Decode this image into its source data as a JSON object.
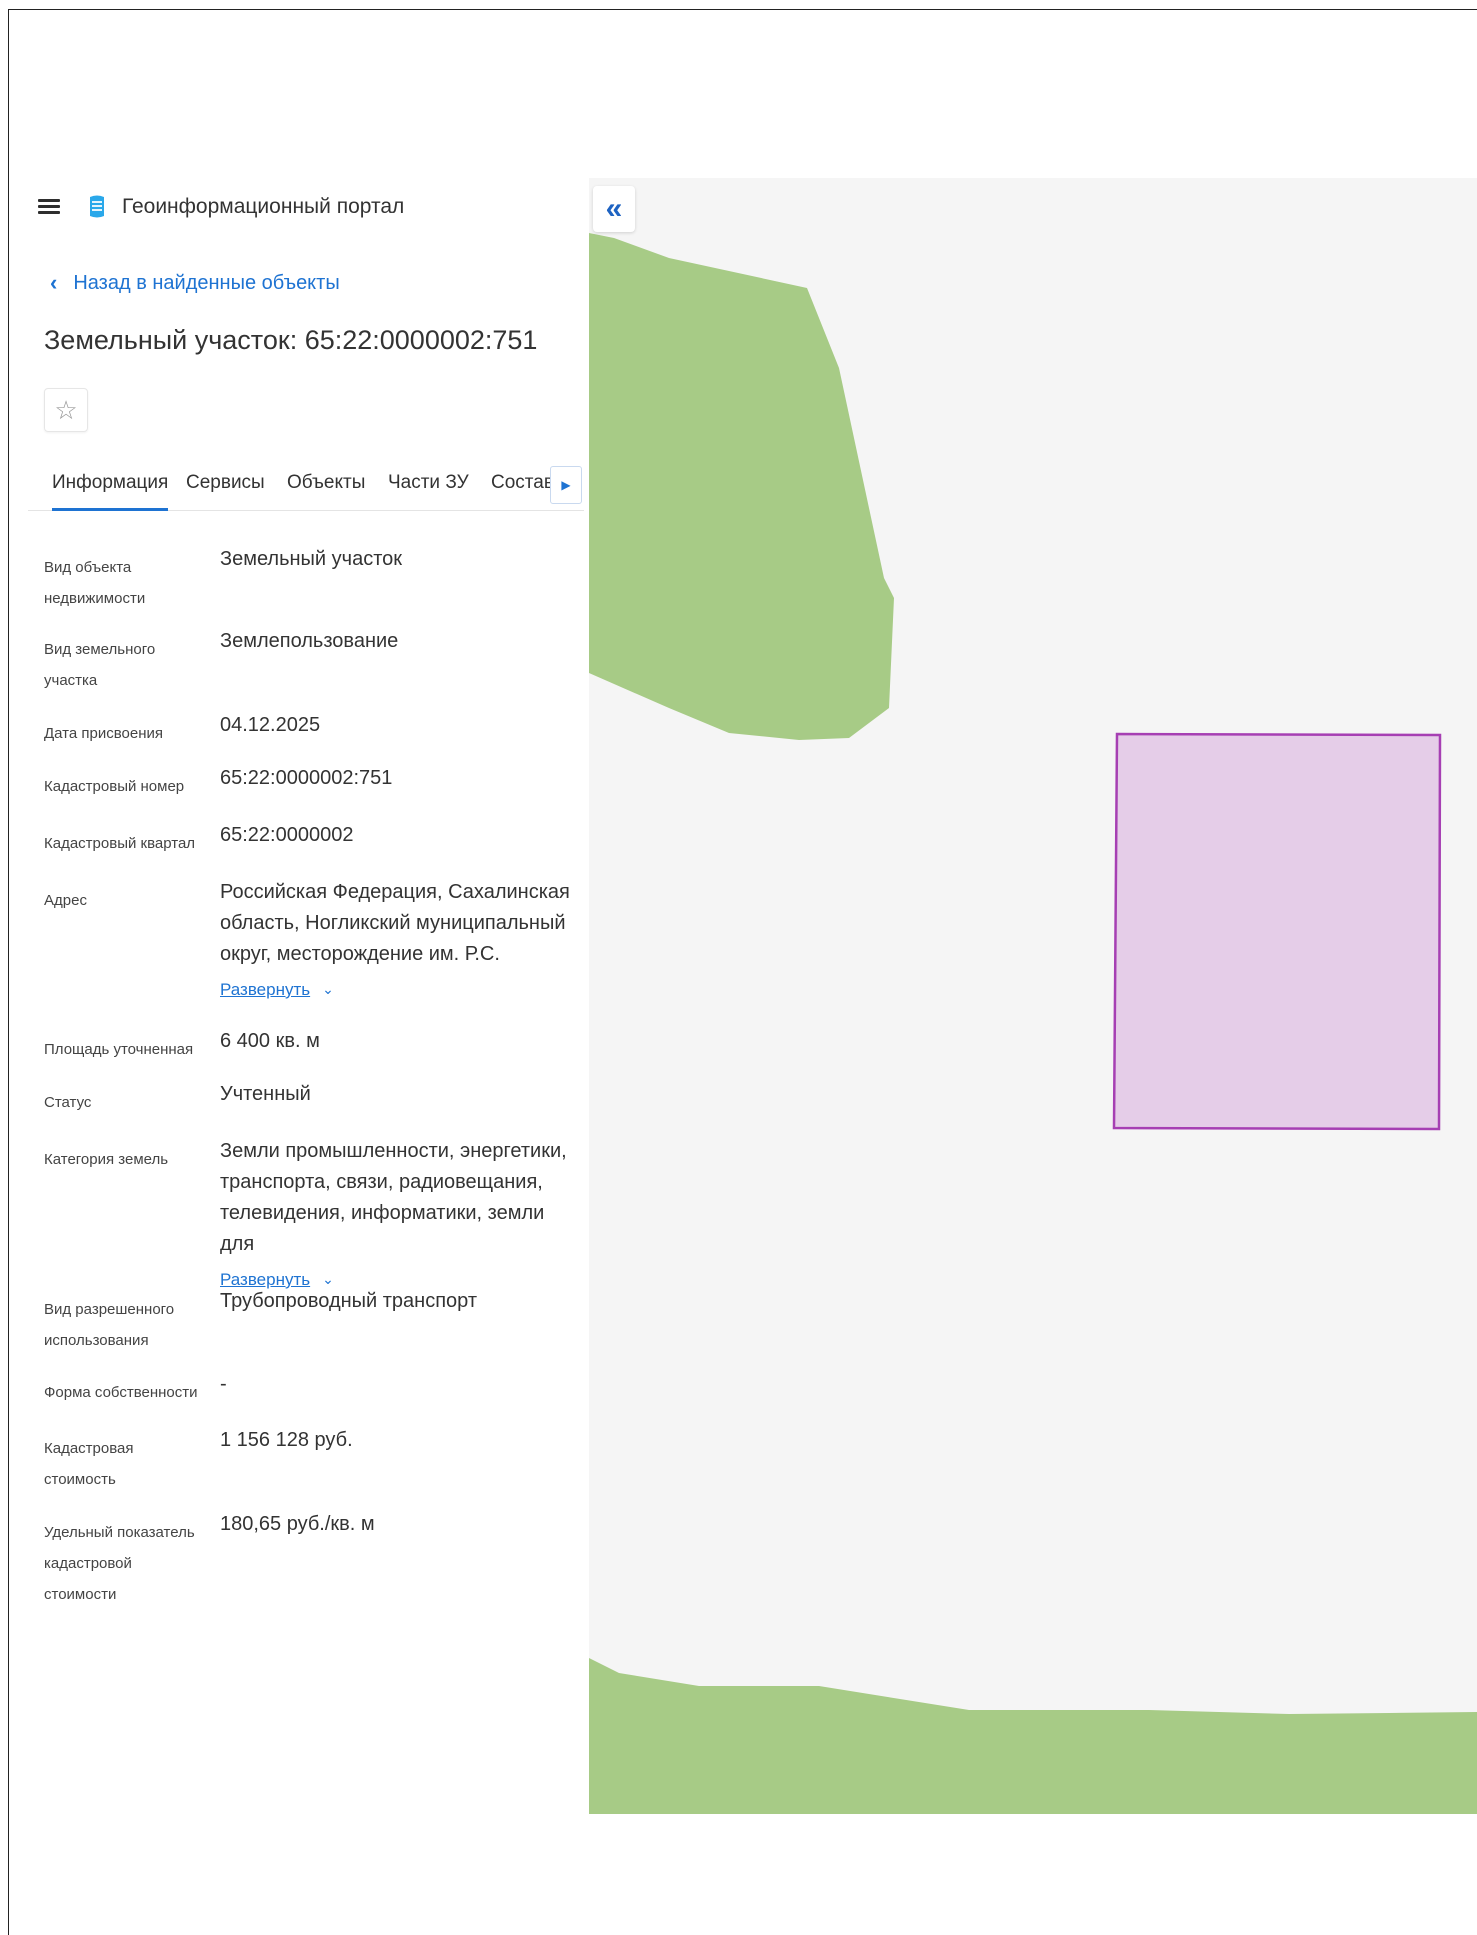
{
  "app": {
    "title": "Геоинформационный портал"
  },
  "nav": {
    "back_label": "Назад в найденные объекты"
  },
  "object": {
    "title": "Земельный участок: 65:22:0000002:751"
  },
  "tabs": [
    {
      "label": "Информация",
      "active": true
    },
    {
      "label": "Сервисы",
      "active": false
    },
    {
      "label": "Объекты",
      "active": false
    },
    {
      "label": "Части ЗУ",
      "active": false
    },
    {
      "label": "Состав",
      "active": false
    }
  ],
  "info": [
    {
      "label": "Вид объекта недвижимости",
      "value": "Земельный участок"
    },
    {
      "label": "Вид земельного участка",
      "value": "Землепользование"
    },
    {
      "label": "Дата присвоения",
      "value": "04.12.2025"
    },
    {
      "label": "Кадастровый номер",
      "value": "65:22:0000002:751"
    },
    {
      "label": "Кадастровый квартал",
      "value": "65:22:0000002"
    },
    {
      "label": "Адрес",
      "value": "Российская Федерация, Сахалинская область, Ногликский муниципальный округ, месторождение им. Р.С.",
      "expand": "Развернуть"
    },
    {
      "label": "Площадь уточненная",
      "value": "6 400 кв. м"
    },
    {
      "label": "Статус",
      "value": "Учтенный"
    },
    {
      "label": "Категория земель",
      "value": "Земли промышленности, энергетики, транспорта, связи, радиовещания, телевидения, информатики, земли для",
      "expand": "Развернуть"
    },
    {
      "label": "Вид разрешенного использования",
      "value": "Трубопроводный транспорт"
    },
    {
      "label": "Форма собственности",
      "value": "-"
    },
    {
      "label": "Кадастровая стоимость",
      "value": "1 156 128 руб."
    },
    {
      "label": "Удельный показатель кадастровой стоимости",
      "value": "180,65 руб./кв. м"
    }
  ],
  "colors": {
    "accent": "#1e73d2",
    "map_background": "#f5f5f5",
    "vegetation": "#a7cb86",
    "parcel_fill": "#e5cde8",
    "parcel_stroke": "#a63fb3"
  },
  "icons": {
    "menu": "hamburger-menu-icon",
    "logo": "portal-logo-icon",
    "back": "chevron-left-icon",
    "favorite": "star-outline-icon",
    "tab_next": "triangle-right-icon",
    "collapse": "double-chevron-left-icon",
    "expand": "chevron-down-icon"
  }
}
